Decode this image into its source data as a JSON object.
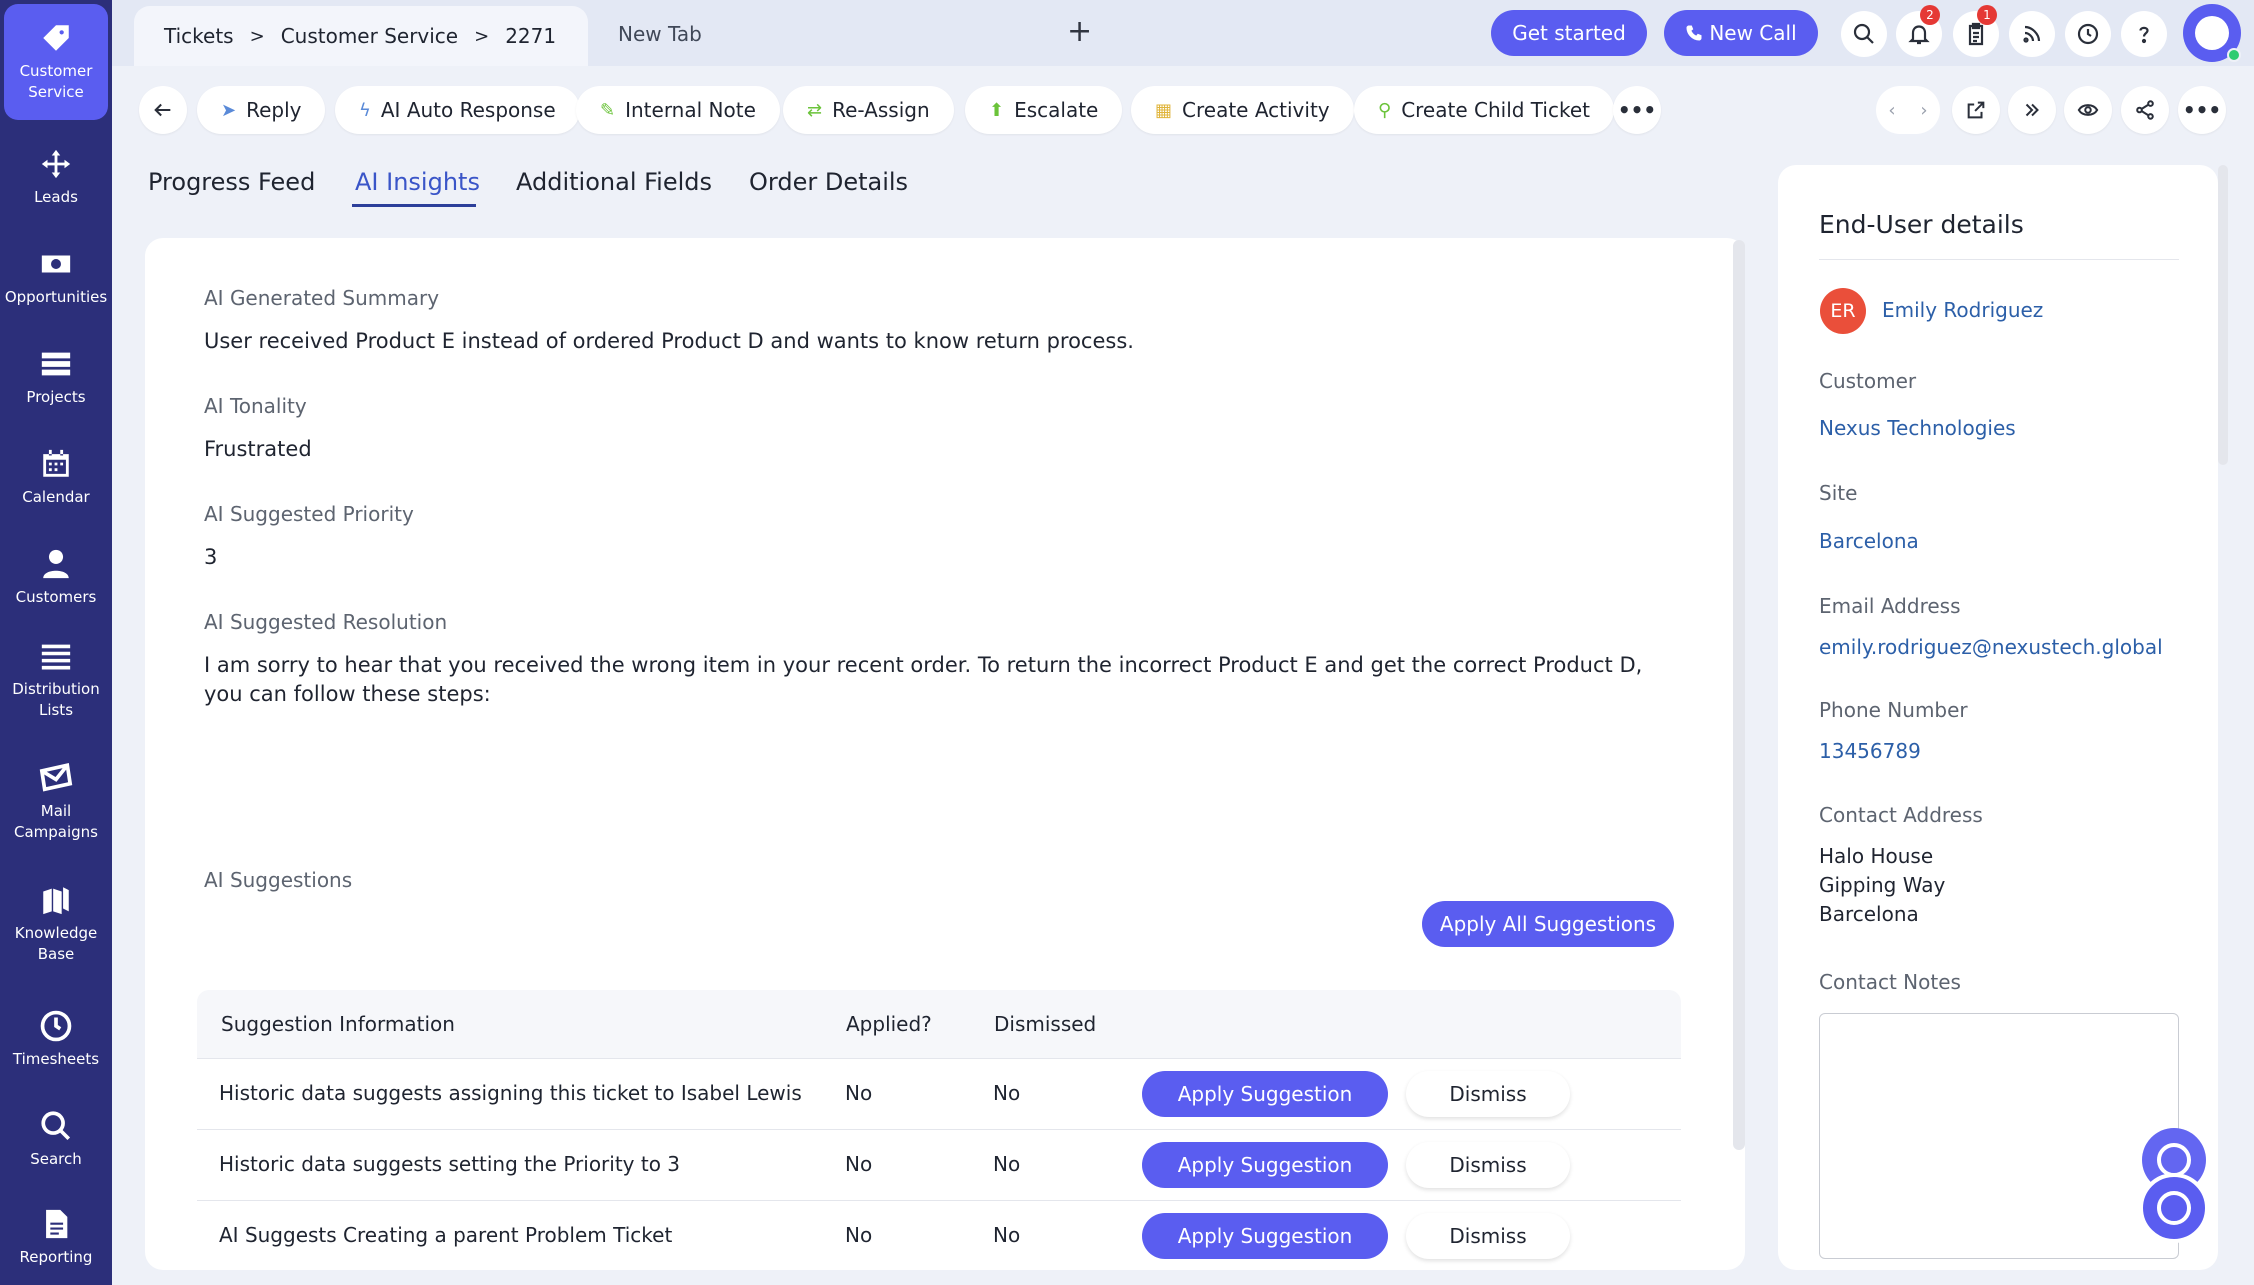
{
  "sidebar": {
    "items": [
      {
        "label": "Customer\nService",
        "icon": "tag-icon"
      },
      {
        "label": "Leads",
        "icon": "move-icon"
      },
      {
        "label": "Opportunities",
        "icon": "money-icon"
      },
      {
        "label": "Projects",
        "icon": "projects-icon"
      },
      {
        "label": "Calendar",
        "icon": "calendar-icon"
      },
      {
        "label": "Customers",
        "icon": "person-icon"
      },
      {
        "label": "Distribution\nLists",
        "icon": "list-icon"
      },
      {
        "label": "Mail\nCampaigns",
        "icon": "mail-icon"
      },
      {
        "label": "Knowledge\nBase",
        "icon": "books-icon"
      },
      {
        "label": "Timesheets",
        "icon": "clock-icon"
      },
      {
        "label": "Search",
        "icon": "search-icon"
      },
      {
        "label": "Reporting",
        "icon": "report-icon"
      }
    ]
  },
  "tabs": {
    "breadcrumb": [
      "Tickets",
      "Customer Service",
      "2271"
    ],
    "separator": ">",
    "new_tab": "New Tab",
    "plus": "+"
  },
  "header": {
    "get_started": "Get started",
    "new_call": "New Call",
    "notifications_count": "2",
    "tasks_count": "1"
  },
  "actions": {
    "reply": "Reply",
    "ai_auto_response": "AI Auto Response",
    "internal_note": "Internal Note",
    "reassign": "Re-Assign",
    "escalate": "Escalate",
    "create_activity": "Create Activity",
    "create_child_ticket": "Create Child Ticket"
  },
  "content_tabs": [
    "Progress Feed",
    "AI Insights",
    "Additional Fields",
    "Order Details"
  ],
  "insights": {
    "summary_label": "AI Generated Summary",
    "summary_value": "User received Product E instead of ordered Product D and wants to know return process.",
    "tonality_label": "AI Tonality",
    "tonality_value": "Frustrated",
    "priority_label": "AI Suggested Priority",
    "priority_value": "3",
    "resolution_label": "AI Suggested Resolution",
    "resolution_value": "I am sorry to hear that you received the wrong item in your recent order. To return the incorrect Product E and get the correct Product D, you can follow these steps:",
    "suggestions_label": "AI Suggestions",
    "apply_all": "Apply All Suggestions"
  },
  "suggestions_table": {
    "headers": [
      "Suggestion Information",
      "Applied?",
      "Dismissed"
    ],
    "apply_label": "Apply Suggestion",
    "dismiss_label": "Dismiss",
    "rows": [
      {
        "info": "Historic data suggests assigning this ticket to Isabel Lewis",
        "applied": "No",
        "dismissed": "No"
      },
      {
        "info": "Historic data suggests setting the Priority to 3",
        "applied": "No",
        "dismissed": "No"
      },
      {
        "info": "AI Suggests Creating a parent Problem Ticket",
        "applied": "No",
        "dismissed": "No"
      }
    ]
  },
  "end_user": {
    "title": "End-User details",
    "initials": "ER",
    "name": "Emily Rodriguez",
    "customer_label": "Customer",
    "customer": "Nexus Technologies",
    "site_label": "Site",
    "site": "Barcelona",
    "email_label": "Email Address",
    "email": "emily.rodriguez@nexustech.global",
    "phone_label": "Phone Number",
    "phone": "13456789",
    "address_label": "Contact Address",
    "address_lines": [
      "Halo House",
      "Gipping Way",
      "Barcelona"
    ],
    "notes_label": "Contact Notes"
  },
  "colors": {
    "sidebar_bg": "#2c2f7a",
    "accent": "#5a5df0",
    "link": "#2c5fa8",
    "avatar_bg": "#ea4f3a"
  }
}
